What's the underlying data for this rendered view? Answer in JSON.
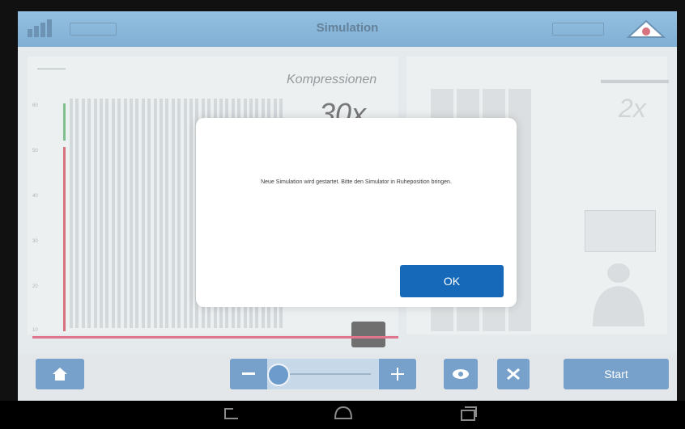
{
  "titlebar": {
    "title": "Simulation",
    "icons": [
      "signal-icon",
      "battery-icon",
      "battery-icon",
      "logo-icon"
    ]
  },
  "main": {
    "compressions_label": "Kompressionen",
    "compressions_value": "30x",
    "breaths_value": "2x",
    "y_ticks": [
      "60",
      "50",
      "40",
      "30",
      "20",
      "10"
    ]
  },
  "dialog": {
    "message": "Neue Simulation wird gestartet. Bitte den Simulator in Ruheposition bringen.",
    "ok_label": "OK"
  },
  "toolbar": {
    "start_label": "Start",
    "icons": [
      "home-icon",
      "minus-icon",
      "plus-icon",
      "eye-icon",
      "stop-icon"
    ]
  },
  "navbar": {
    "icons": [
      "back-icon",
      "home-nav-icon",
      "recent-apps-icon"
    ]
  },
  "colors": {
    "accent": "#2e6fae",
    "titlebar": "#4a92c8",
    "compression_line": "#c2283a",
    "pressure_line": "#3b9b52"
  }
}
